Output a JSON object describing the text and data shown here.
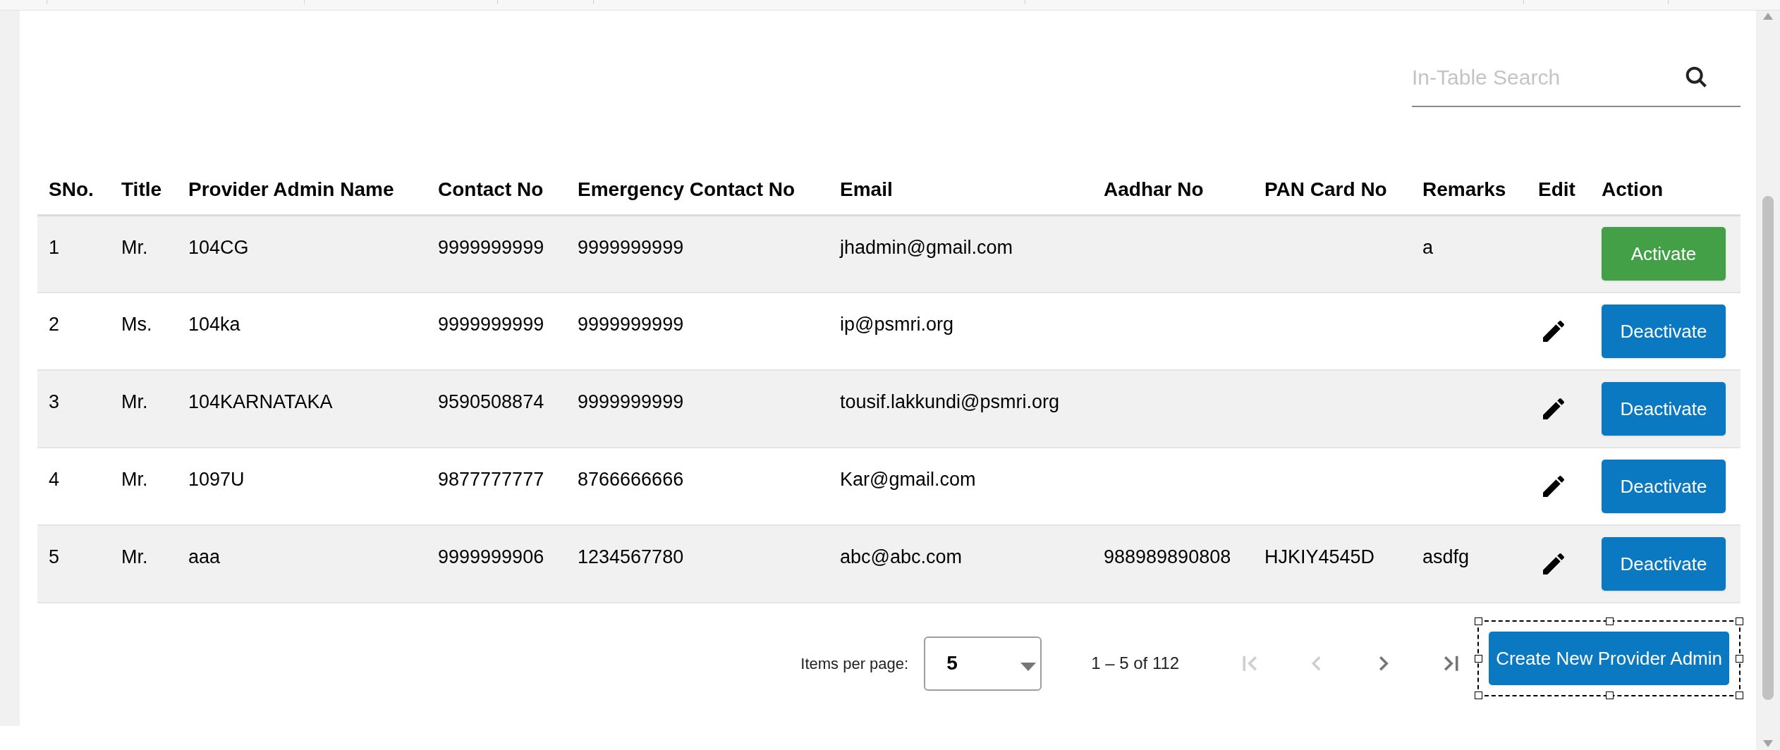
{
  "search": {
    "placeholder": "In-Table Search"
  },
  "table": {
    "columns": [
      "SNo.",
      "Title",
      "Provider Admin Name",
      "Contact No",
      "Emergency Contact No",
      "Email",
      "Aadhar No",
      "PAN Card No",
      "Remarks",
      "Edit",
      "Action"
    ],
    "rows": [
      {
        "sno": "1",
        "title": "Mr.",
        "name": "104CG",
        "contact": "9999999999",
        "emergency": "9999999999",
        "email": "jhadmin@gmail.com",
        "aadhar": "",
        "pan": "",
        "remarks": "a",
        "editable": false,
        "action": {
          "kind": "activate",
          "label": "Activate"
        }
      },
      {
        "sno": "2",
        "title": "Ms.",
        "name": "104ka",
        "contact": "9999999999",
        "emergency": "9999999999",
        "email": "ip@psmri.org",
        "aadhar": "",
        "pan": "",
        "remarks": "",
        "editable": true,
        "action": {
          "kind": "deactivate",
          "label": "Deactivate"
        }
      },
      {
        "sno": "3",
        "title": "Mr.",
        "name": "104KARNATAKA",
        "contact": "9590508874",
        "emergency": "9999999999",
        "email": "tousif.lakkundi@psmri.org",
        "aadhar": "",
        "pan": "",
        "remarks": "",
        "editable": true,
        "action": {
          "kind": "deactivate",
          "label": "Deactivate"
        }
      },
      {
        "sno": "4",
        "title": "Mr.",
        "name": "1097U",
        "contact": "9877777777",
        "emergency": "8766666666",
        "email": "Kar@gmail.com",
        "aadhar": "",
        "pan": "",
        "remarks": "",
        "editable": true,
        "action": {
          "kind": "deactivate",
          "label": "Deactivate"
        }
      },
      {
        "sno": "5",
        "title": "Mr.",
        "name": "aaa",
        "contact": "9999999906",
        "emergency": "1234567780",
        "email": "abc@abc.com",
        "aadhar": "988989890808",
        "pan": "HJKIY4545D",
        "remarks": "asdfg",
        "editable": true,
        "action": {
          "kind": "deactivate",
          "label": "Deactivate"
        }
      }
    ]
  },
  "paginator": {
    "items_per_page_label": "Items per page:",
    "page_size": "5",
    "range_label": "1 – 5 of 112",
    "nav": [
      {
        "kind": "first",
        "disabled": true
      },
      {
        "kind": "prev",
        "disabled": true
      },
      {
        "kind": "next",
        "disabled": false
      },
      {
        "kind": "last",
        "disabled": false
      }
    ]
  },
  "create_button": {
    "label": "Create New Provider Admin",
    "selected": true
  }
}
